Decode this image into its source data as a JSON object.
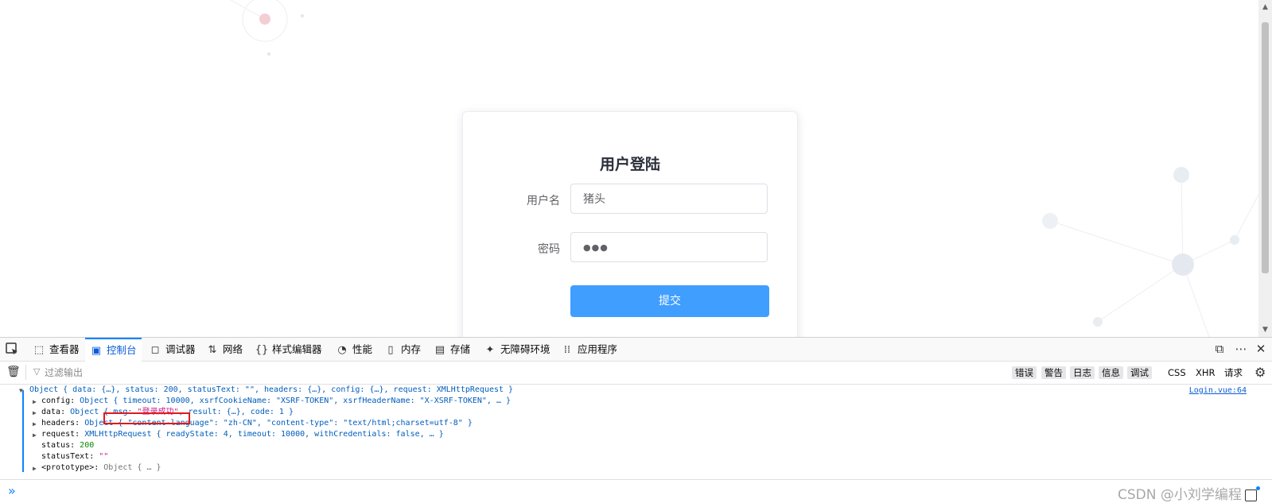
{
  "login": {
    "title": "用户登陆",
    "username_label": "用户名",
    "username_value": "猪头",
    "password_label": "密码",
    "password_value": "●●●",
    "submit_label": "提交"
  },
  "devtools": {
    "tabs": [
      {
        "label": "查看器",
        "icon": "inspector-icon"
      },
      {
        "label": "控制台",
        "icon": "console-icon",
        "active": true
      },
      {
        "label": "调试器",
        "icon": "debugger-icon"
      },
      {
        "label": "网络",
        "icon": "network-icon"
      },
      {
        "label": "样式编辑器",
        "icon": "style-editor-icon"
      },
      {
        "label": "性能",
        "icon": "performance-icon"
      },
      {
        "label": "内存",
        "icon": "memory-icon"
      },
      {
        "label": "存储",
        "icon": "storage-icon"
      },
      {
        "label": "无障碍环境",
        "icon": "accessibility-icon"
      },
      {
        "label": "应用程序",
        "icon": "application-icon"
      }
    ],
    "filter_placeholder": "过滤输出",
    "levels": [
      "错误",
      "警告",
      "日志",
      "信息",
      "调试"
    ],
    "net_filters": [
      "CSS",
      "XHR",
      "请求"
    ]
  },
  "console": {
    "source": "Login.vue:64",
    "line_object": "Object { data: {…}, status: 200, statusText: \"\", headers: {…}, config: {…}, request: XMLHttpRequest }",
    "line_config_key": "config: ",
    "line_config_val": "Object { timeout: 10000, xsrfCookieName: \"XSRF-TOKEN\", xsrfHeaderName: \"X-XSRF-TOKEN\", … }",
    "line_data_key": "data: ",
    "line_data_val_a": "Object { msg: ",
    "line_data_msg": "\"登录成功\"",
    "line_data_val_b": ", result: {…}, code: 1 }",
    "line_headers_key": "headers: ",
    "line_headers_val": "Object { \"content-language\": \"zh-CN\", \"content-type\": \"text/html;charset=utf-8\" }",
    "line_request_key": "request: ",
    "line_request_val": "XMLHttpRequest { readyState: 4, timeout: 10000, withCredentials: false, … }",
    "line_status_key": "status: ",
    "line_status_val": "200",
    "line_statustext_key": "statusText: ",
    "line_statustext_val": "\"\"",
    "line_proto_key": "<prototype>: ",
    "line_proto_val": "Object { … }"
  },
  "watermark": "CSDN @小刘学编程",
  "colors": {
    "primary_button": "#409eff",
    "console_string": "#c71c8a",
    "console_number": "#058b00",
    "active_tab": "#0a84ff",
    "highlight_box": "#e01a1a"
  }
}
